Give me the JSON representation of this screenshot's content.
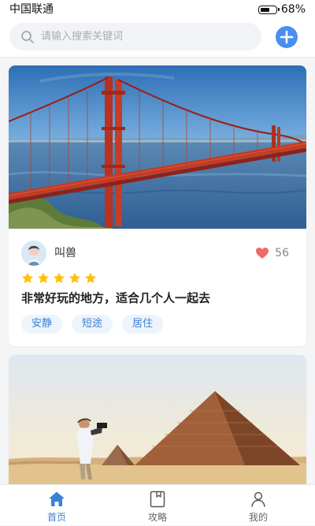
{
  "status_bar": {
    "carrier": "中国联通",
    "battery_text": "68%",
    "battery_level": 0.68
  },
  "search": {
    "placeholder": "请输入搜索关键词",
    "search_icon": "search-icon",
    "add_icon": "plus-icon"
  },
  "feed": {
    "cards": [
      {
        "image": "golden-gate-bridge-photo",
        "author": "叫兽",
        "likes": "56",
        "rating": 5,
        "review": "非常好玩的地方，适合几个人一起去",
        "tags": [
          "安静",
          "短途",
          "居住"
        ]
      },
      {
        "image": "pyramid-photo"
      }
    ]
  },
  "bottom_nav": {
    "items": [
      {
        "label": "首页",
        "icon": "home-icon",
        "active": true
      },
      {
        "label": "攻略",
        "icon": "book-icon",
        "active": false
      },
      {
        "label": "我的",
        "icon": "user-icon",
        "active": false
      }
    ]
  },
  "colors": {
    "accent": "#3A82D6",
    "star": "#FFC107",
    "heart": "#F06A6A"
  }
}
